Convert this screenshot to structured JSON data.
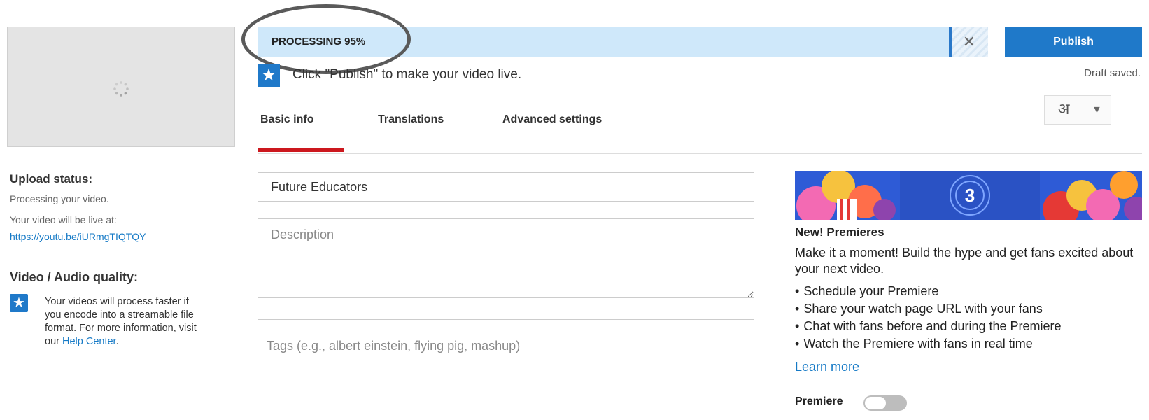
{
  "upload": {
    "status_title": "Upload status:",
    "status_text": "Processing your video.",
    "live_at_label": "Your video will be live at:",
    "live_url": "https://youtu.be/iURmgTIQTQY",
    "quality_title": "Video / Audio quality:",
    "quality_text": "Your videos will process faster if you encode into a streamable file format. For more information, visit our",
    "help_link": "Help Center",
    "help_suffix": "."
  },
  "progress": {
    "label": "PROCESSING 95%",
    "percent": 95,
    "cancel_icon": "close-icon"
  },
  "publish": {
    "label": "Publish",
    "draft_status": "Draft saved.",
    "language_glyph": "अ"
  },
  "hint": {
    "icon": "star-icon",
    "text": "Click \"Publish\" to make your video live."
  },
  "tabs": [
    {
      "label": "Basic info",
      "active": true
    },
    {
      "label": "Translations",
      "active": false
    },
    {
      "label": "Advanced settings",
      "active": false
    }
  ],
  "form": {
    "title_value": "Future Educators",
    "description_placeholder": "Description",
    "tags_placeholder": "Tags (e.g., albert einstein, flying pig, mashup)"
  },
  "premieres": {
    "banner_number": "3",
    "title": "New! Premieres",
    "description": "Make it a moment! Build the hype and get fans excited about your next video.",
    "bullets": [
      "Schedule your Premiere",
      "Share your watch page URL with your fans",
      "Chat with fans before and during the Premiere",
      "Watch the Premiere with fans in real time"
    ],
    "learn_more": "Learn more",
    "toggle_label": "Premiere",
    "toggle_on": false
  },
  "colors": {
    "accent_blue": "#1f79c9",
    "link_blue": "#167ac6",
    "tab_red": "#cc181e",
    "progress_bg": "#cfe8fa"
  }
}
